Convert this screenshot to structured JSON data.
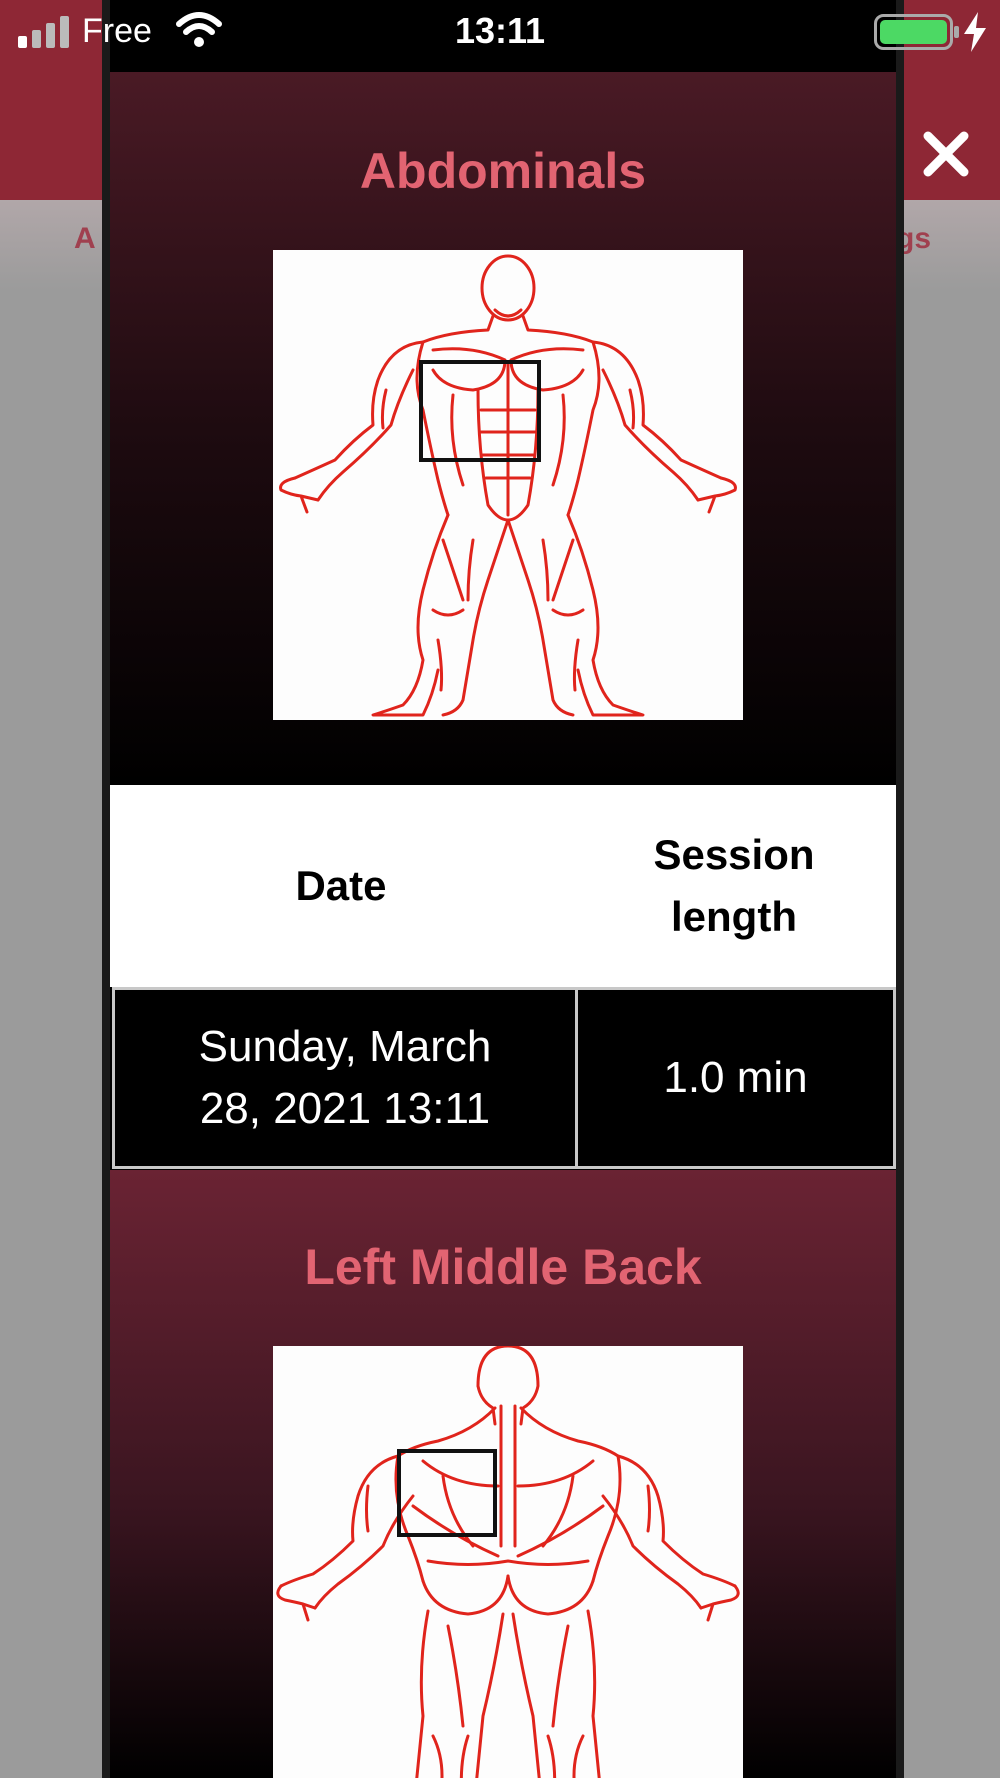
{
  "status_bar": {
    "carrier": "Free",
    "time": "13:11",
    "battery_color": "#4cd964"
  },
  "background": {
    "header_color": "#8e2735",
    "tab_left_partial": "A",
    "tab_right_partial": "gs",
    "close_icon": "close-icon"
  },
  "sections": [
    {
      "title": "Abdominals",
      "figure": "front-body-figure"
    },
    {
      "title": "Left Middle Back",
      "figure": "back-body-figure"
    }
  ],
  "table": {
    "headers": [
      "Date",
      "Session length"
    ],
    "header_date": "Date",
    "header_length_line1": "Session",
    "header_length_line2": "length",
    "rows": [
      {
        "date_line1": "Sunday, March",
        "date_line2": "28, 2021 13:11",
        "length": "1.0 min"
      }
    ]
  },
  "colors": {
    "accent_title": "#e26472",
    "muscle_line": "#e0241c",
    "modal_bg": "#000000"
  }
}
